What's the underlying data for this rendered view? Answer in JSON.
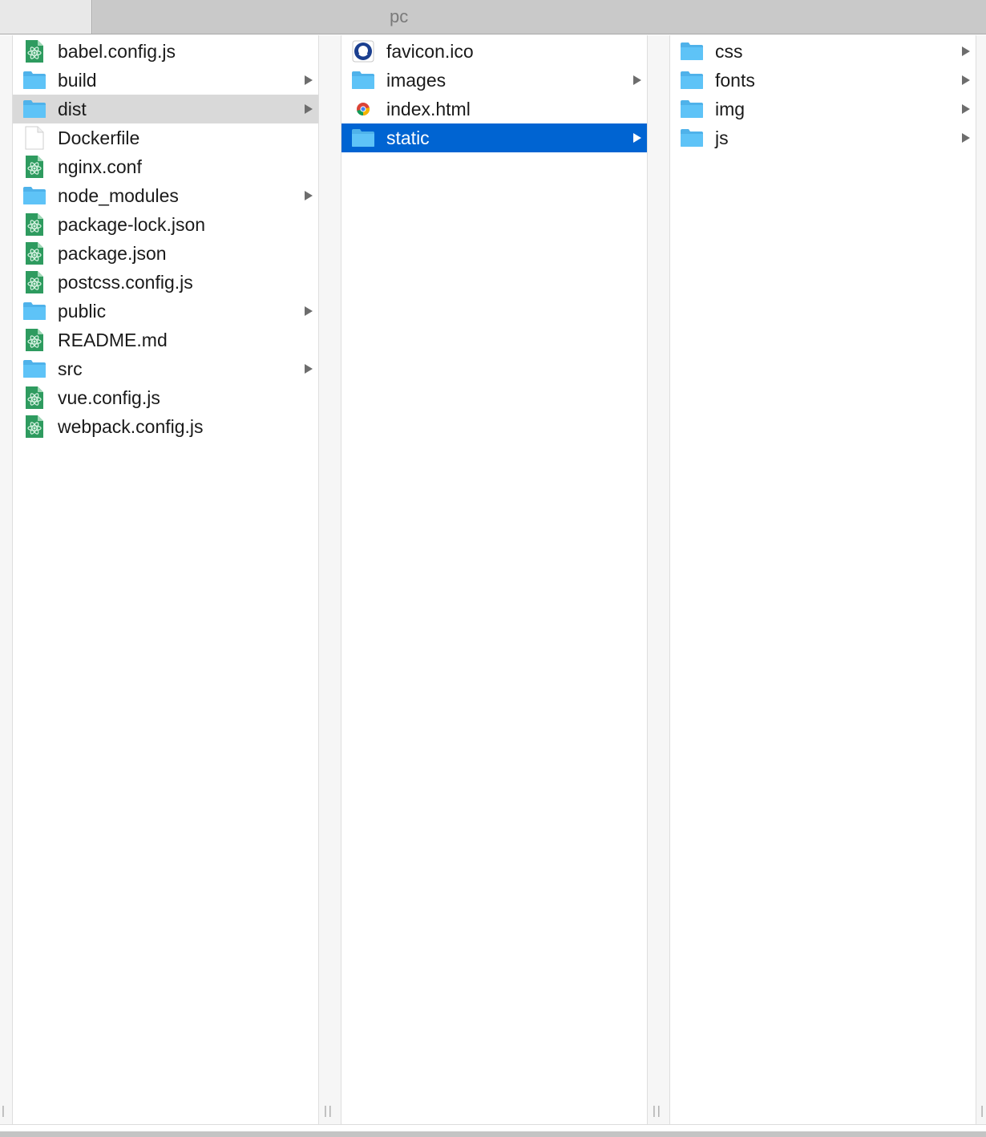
{
  "window": {
    "title": "pc"
  },
  "columns": [
    {
      "items": [
        {
          "label": "babel.config.js",
          "icon": "atom-file-icon",
          "type": "file",
          "selected": "none"
        },
        {
          "label": "build",
          "icon": "folder-icon",
          "type": "folder",
          "selected": "none"
        },
        {
          "label": "dist",
          "icon": "folder-icon",
          "type": "folder",
          "selected": "inactive"
        },
        {
          "label": "Dockerfile",
          "icon": "blank-file-icon",
          "type": "file",
          "selected": "none"
        },
        {
          "label": "nginx.conf",
          "icon": "atom-file-icon",
          "type": "file",
          "selected": "none"
        },
        {
          "label": "node_modules",
          "icon": "folder-icon",
          "type": "folder",
          "selected": "none"
        },
        {
          "label": "package-lock.json",
          "icon": "atom-file-icon",
          "type": "file",
          "selected": "none"
        },
        {
          "label": "package.json",
          "icon": "atom-file-icon",
          "type": "file",
          "selected": "none"
        },
        {
          "label": "postcss.config.js",
          "icon": "atom-file-icon",
          "type": "file",
          "selected": "none"
        },
        {
          "label": "public",
          "icon": "folder-icon",
          "type": "folder",
          "selected": "none"
        },
        {
          "label": "README.md",
          "icon": "atom-file-icon",
          "type": "file",
          "selected": "none"
        },
        {
          "label": "src",
          "icon": "folder-icon",
          "type": "folder",
          "selected": "none"
        },
        {
          "label": "vue.config.js",
          "icon": "atom-file-icon",
          "type": "file",
          "selected": "none"
        },
        {
          "label": "webpack.config.js",
          "icon": "atom-file-icon",
          "type": "file",
          "selected": "none"
        }
      ]
    },
    {
      "items": [
        {
          "label": "favicon.ico",
          "icon": "favicon-icon",
          "type": "file",
          "selected": "none"
        },
        {
          "label": "images",
          "icon": "folder-icon",
          "type": "folder",
          "selected": "none"
        },
        {
          "label": "index.html",
          "icon": "chrome-icon",
          "type": "file",
          "selected": "none"
        },
        {
          "label": "static",
          "icon": "folder-icon",
          "type": "folder",
          "selected": "active"
        }
      ]
    },
    {
      "items": [
        {
          "label": "css",
          "icon": "folder-icon",
          "type": "folder",
          "selected": "none"
        },
        {
          "label": "fonts",
          "icon": "folder-icon",
          "type": "folder",
          "selected": "none"
        },
        {
          "label": "img",
          "icon": "folder-icon",
          "type": "folder",
          "selected": "none"
        },
        {
          "label": "js",
          "icon": "folder-icon",
          "type": "folder",
          "selected": "none"
        }
      ]
    }
  ],
  "colors": {
    "selection_active": "#0064d2",
    "selection_inactive": "#d9d9d9",
    "folder": "#5ec3f7",
    "atom_file": "#2e9b5f"
  }
}
